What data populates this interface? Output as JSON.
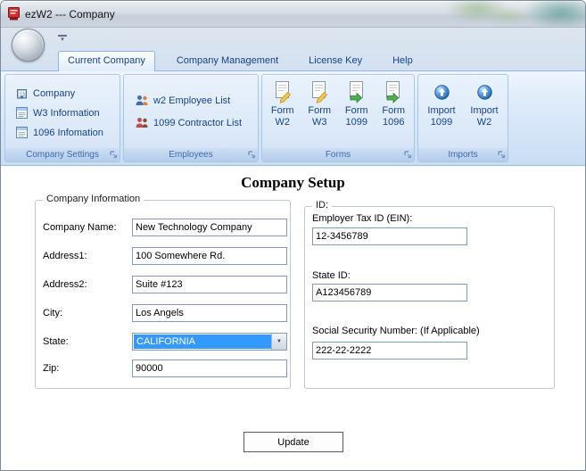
{
  "window": {
    "title": "ezW2 --- Company"
  },
  "tabs": [
    {
      "label": "Current Company"
    },
    {
      "label": "Company Management"
    },
    {
      "label": "License Key"
    },
    {
      "label": "Help"
    }
  ],
  "ribbon": {
    "company_settings": {
      "caption": "Company Settings",
      "items": [
        {
          "label": "Company"
        },
        {
          "label": "W3 Information"
        },
        {
          "label": "1096 Infomation"
        }
      ]
    },
    "employees": {
      "caption": "Employees",
      "items": [
        {
          "label": "w2 Employee List"
        },
        {
          "label": "1099 Contractor List"
        }
      ]
    },
    "forms": {
      "caption": "Forms",
      "items": [
        {
          "line1": "Form",
          "line2": "W2"
        },
        {
          "line1": "Form",
          "line2": "W3"
        },
        {
          "line1": "Form",
          "line2": "1099"
        },
        {
          "line1": "Form",
          "line2": "1096"
        }
      ]
    },
    "imports": {
      "caption": "Imports",
      "items": [
        {
          "line1": "Import",
          "line2": "1099"
        },
        {
          "line1": "Import",
          "line2": "W2"
        }
      ]
    }
  },
  "main": {
    "title": "Company Setup",
    "company_info": {
      "legend": "Company Information",
      "company_name": {
        "label": "Company Name:",
        "value": "New Technology Company"
      },
      "address1": {
        "label": "Address1:",
        "value": "100 Somewhere Rd."
      },
      "address2": {
        "label": "Address2:",
        "value": "Suite #123"
      },
      "city": {
        "label": "City:",
        "value": "Los Angels"
      },
      "state": {
        "label": "State:",
        "value": "CALIFORNIA"
      },
      "zip": {
        "label": "Zip:",
        "value": "90000"
      }
    },
    "id_info": {
      "legend": "ID:",
      "ein": {
        "label": "Employer Tax ID (EIN):",
        "value": "12-3456789"
      },
      "state_id": {
        "label": "State ID:",
        "value": "A123456789"
      },
      "ssn": {
        "label": "Social Security Number: (If Applicable)",
        "value": "222-22-2222"
      }
    },
    "update_button": "Update"
  },
  "colors": {
    "ribbon_text": "#15428b",
    "selection_blue": "#3399ff",
    "ribbon_border": "#aac6e6"
  }
}
